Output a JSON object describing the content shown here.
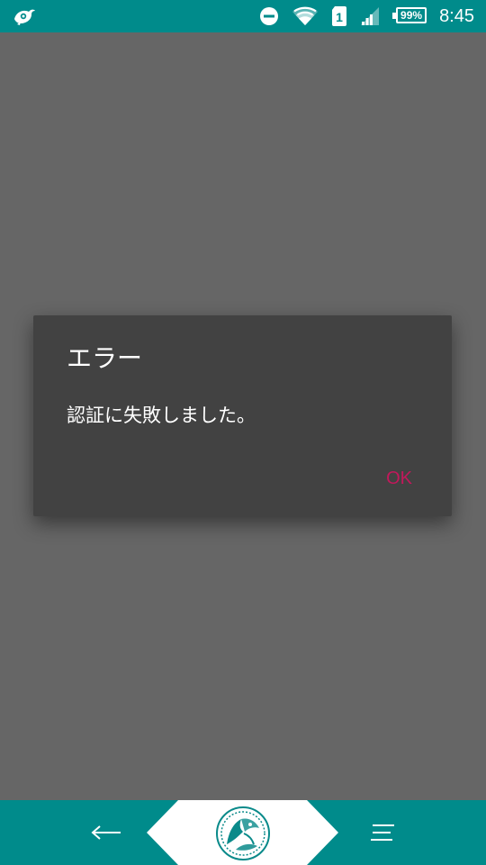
{
  "status_bar": {
    "left_icon": "bird-logo-icon",
    "icons": [
      "do-not-disturb-icon",
      "wifi-icon",
      "sim-1-icon",
      "signal-icon"
    ],
    "sim_label": "1",
    "battery_percent": "99%",
    "time": "8:45",
    "color": "#008b8b"
  },
  "dialog": {
    "title": "エラー",
    "message": "認証に失敗しました。",
    "ok_label": "OK",
    "accent_color": "#c2185b"
  },
  "nav_bar": {
    "back_icon": "back-arrow-icon",
    "home_icon": "home-emblem-icon",
    "menu_icon": "menu-lines-icon",
    "color": "#008b8b"
  }
}
